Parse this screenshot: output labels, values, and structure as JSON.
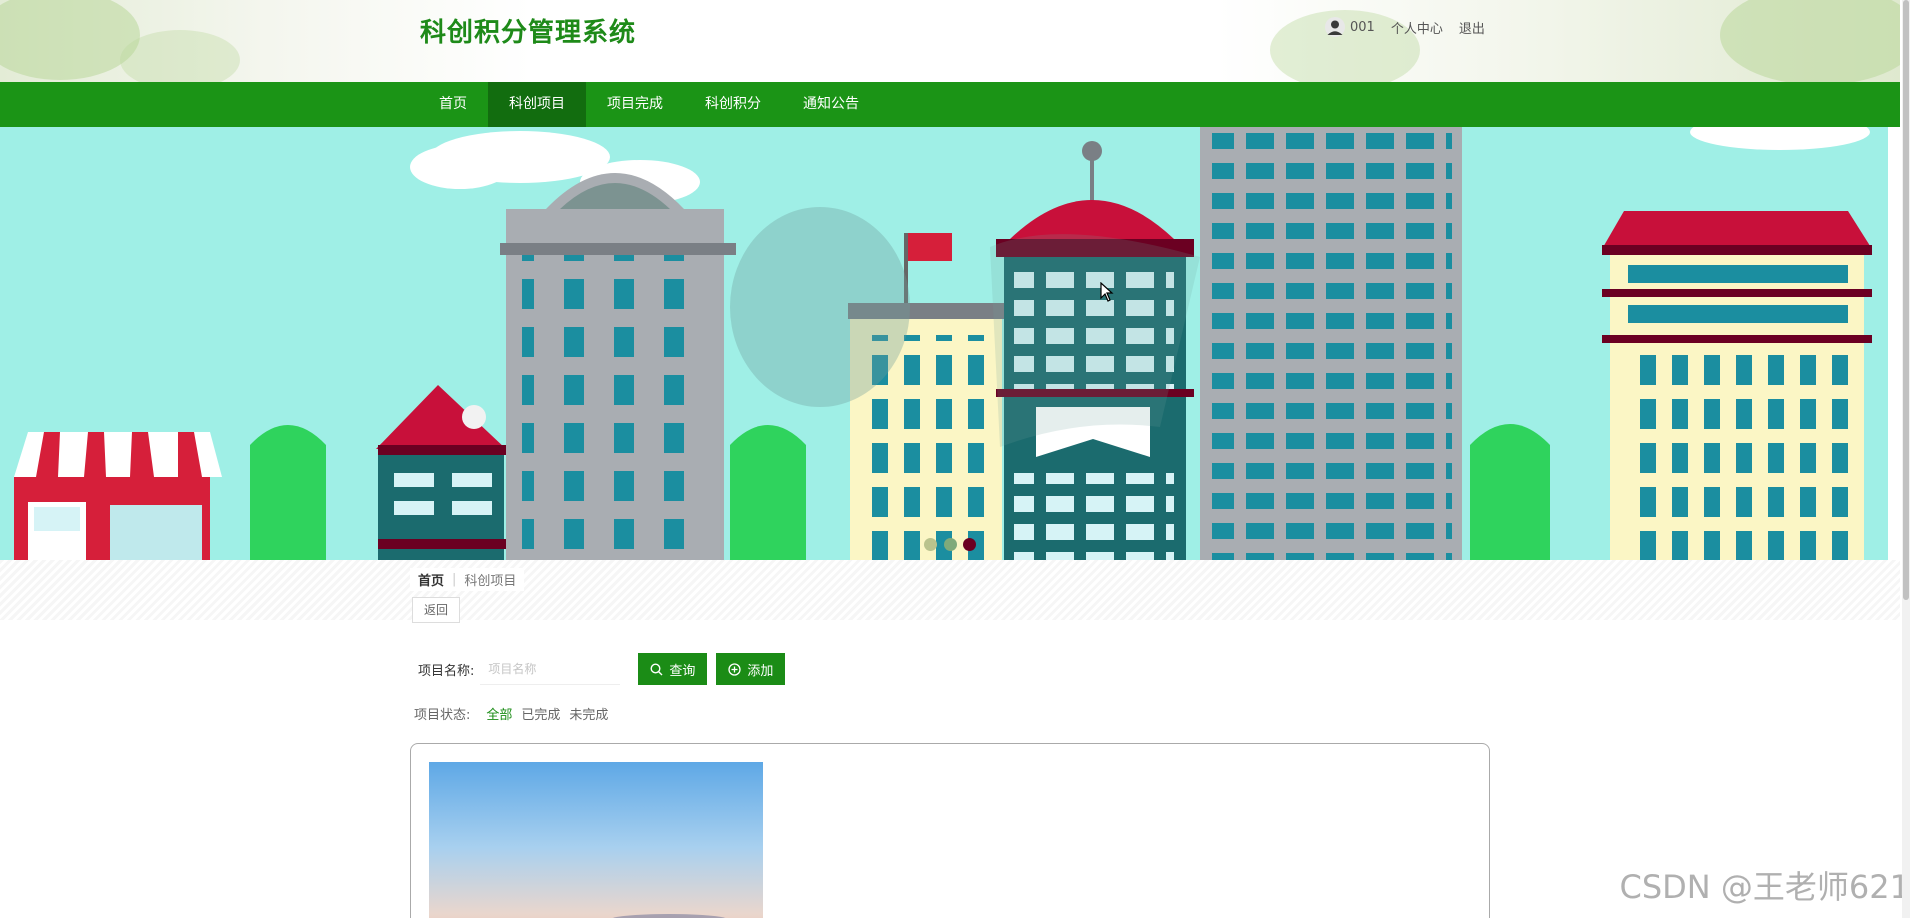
{
  "header": {
    "site_title": "科创积分管理系统",
    "user": {
      "name": "001",
      "profile_link": "个人中心",
      "logout_link": "退出"
    }
  },
  "nav": {
    "items": [
      {
        "label": "首页"
      },
      {
        "label": "科创项目"
      },
      {
        "label": "项目完成"
      },
      {
        "label": "科创积分"
      },
      {
        "label": "通知公告"
      }
    ],
    "active": "科创项目"
  },
  "banner": {
    "slide_count": 3,
    "active_slide": 3
  },
  "breadcrumb": {
    "home": "首页",
    "current": "科创项目"
  },
  "back_button": "返回",
  "search": {
    "label": "项目名称:",
    "placeholder": "项目名称",
    "value": "",
    "query_button": "查询",
    "add_button": "添加"
  },
  "status_filter": {
    "label": "项目状态:",
    "options": [
      "全部",
      "已完成",
      "未完成"
    ],
    "active": "全部"
  },
  "watermark": "CSDN @王老师621",
  "colors": {
    "brand_green": "#1b9416",
    "nav_active": "#126d0f",
    "button_green": "#1b8c16",
    "title_green": "#1e8a19"
  }
}
